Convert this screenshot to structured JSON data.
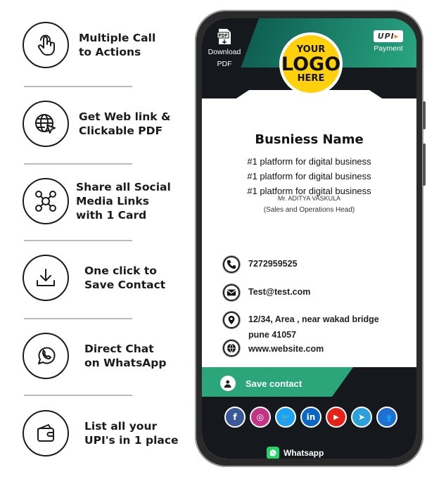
{
  "features": [
    {
      "icon": "tap-hand-icon",
      "text": "Multiple Call\nto Actions"
    },
    {
      "icon": "globe-cursor-icon",
      "text": "Get Web link &\nClickable PDF"
    },
    {
      "icon": "social-network-icon",
      "text": "Share all Social\nMedia Links\nwith 1 Card"
    },
    {
      "icon": "download-icon",
      "text": "One click to\nSave Contact"
    },
    {
      "icon": "whatsapp-icon",
      "text": "Direct Chat\non WhatsApp"
    },
    {
      "icon": "wallet-icon",
      "text": "List all your\nUPI's in 1 place"
    }
  ],
  "card": {
    "pdf_badge": "PDF",
    "download_label_1": "Download",
    "download_label_2": "PDF",
    "upi_logo": "UPI",
    "payment_label": "Payment",
    "logo_line1": "YOUR",
    "logo_line2": "LOGO",
    "logo_line3": "HERE",
    "business_name": "Busniess Name",
    "taglines": [
      "#1 platform for digital business",
      "#1 platform for digital business",
      "#1 platform for digital business"
    ],
    "person_name": "Mr. ADITYA VASKULA",
    "person_role": "(Sales and Operations Head)",
    "contacts": {
      "phone": "7272959525",
      "email": "Test@test.com",
      "address": "12/34, Area , near wakad bridge\npune 41057",
      "website": "www.website.com"
    },
    "save_contact_label": "Save contact",
    "socials": [
      {
        "name": "facebook",
        "glyph": "f",
        "color": "#3b5998"
      },
      {
        "name": "instagram",
        "glyph": "◎",
        "color": "#c13584"
      },
      {
        "name": "twitter",
        "glyph": "🐦",
        "color": "#1da1f2"
      },
      {
        "name": "linkedin",
        "glyph": "in",
        "color": "#0a66c2"
      },
      {
        "name": "youtube",
        "glyph": "▶",
        "color": "#e62117"
      },
      {
        "name": "telegram",
        "glyph": "➤",
        "color": "#2aa1da"
      },
      {
        "name": "contacts",
        "glyph": "👥",
        "color": "#1f6fd1"
      }
    ],
    "whatsapp_label": "Whatsapp"
  },
  "colors": {
    "accent_green": "#2aa67a",
    "dark": "#15191d",
    "logo_yellow": "#ffd10c"
  }
}
